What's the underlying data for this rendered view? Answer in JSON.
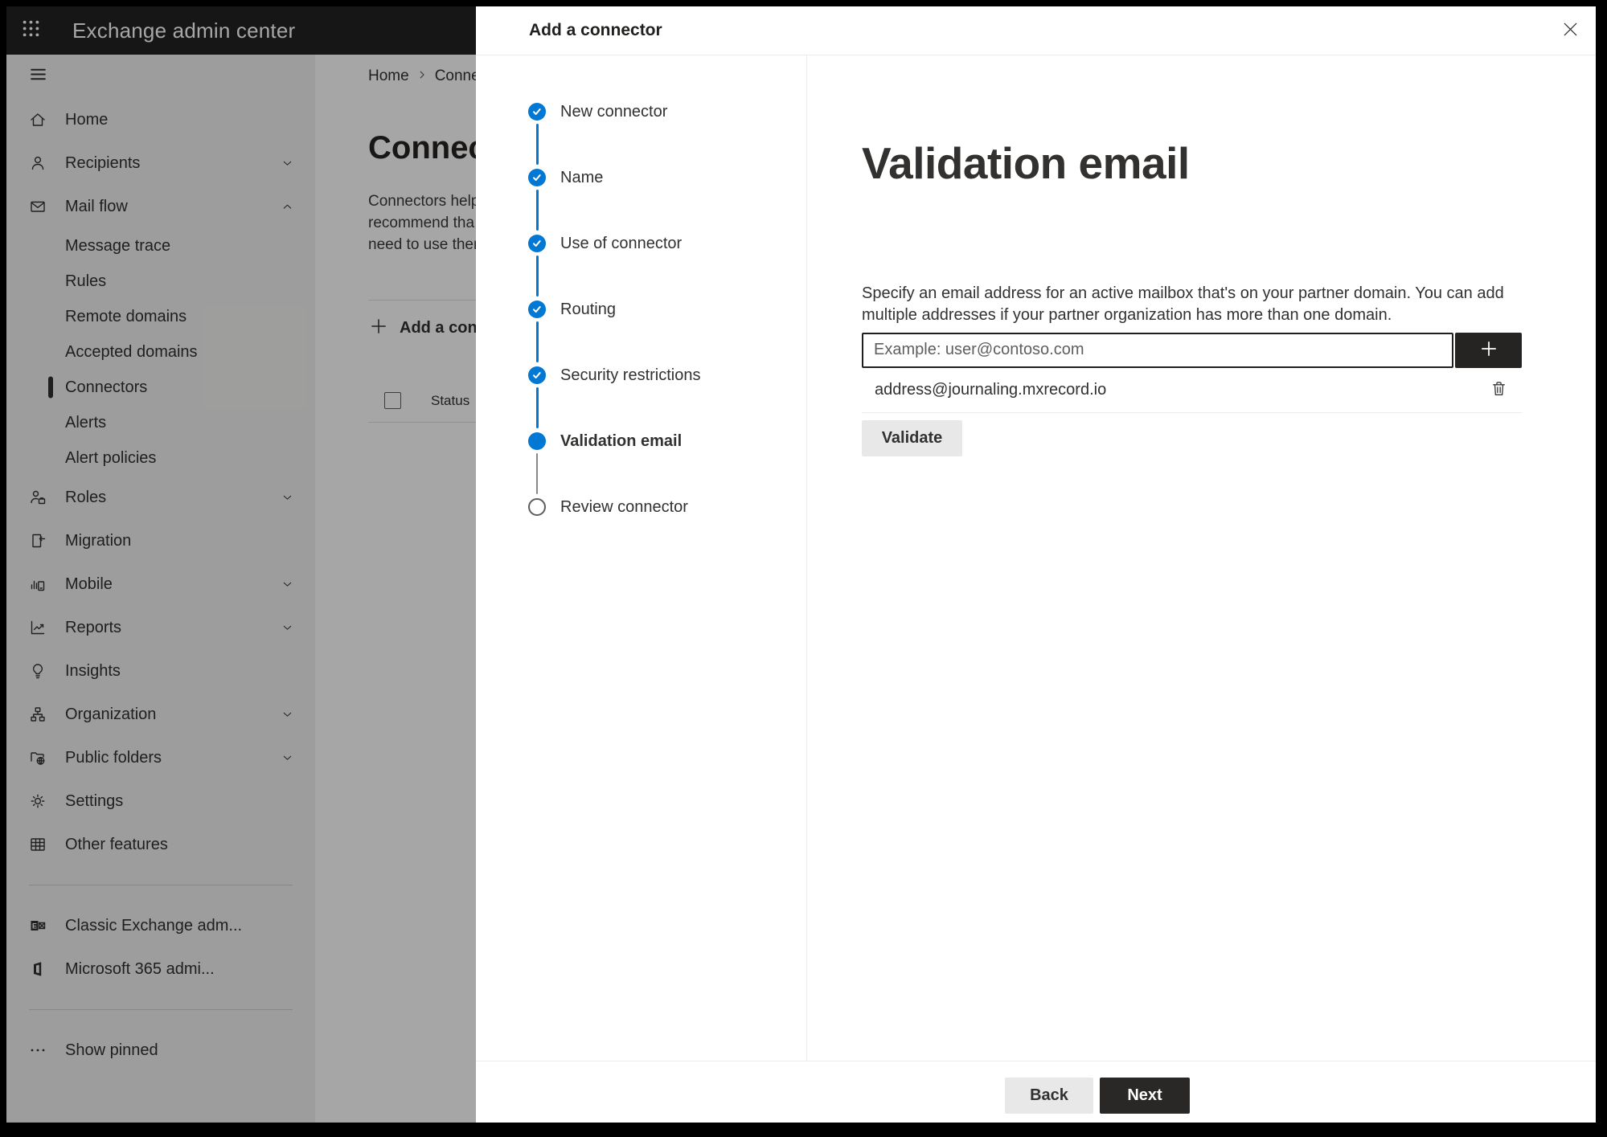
{
  "colors": {
    "accent_blue": "#0078d4",
    "dark_button": "#292827",
    "topbar": "#242322",
    "sidebar_bg": "#f3f2f1",
    "overlay": "rgba(0,0,0,0.35)"
  },
  "topbar": {
    "title": "Exchange admin center",
    "waffle_icon": "app-launcher-icon"
  },
  "sidebar": {
    "items": [
      {
        "label": "Home",
        "icon": "home-icon",
        "type": "top"
      },
      {
        "label": "Recipients",
        "icon": "person-icon",
        "type": "top",
        "chevron": "down"
      },
      {
        "label": "Mail flow",
        "icon": "mail-icon",
        "type": "top",
        "chevron": "up"
      },
      {
        "label": "Message trace",
        "type": "sub"
      },
      {
        "label": "Rules",
        "type": "sub"
      },
      {
        "label": "Remote domains",
        "type": "sub"
      },
      {
        "label": "Accepted domains",
        "type": "sub"
      },
      {
        "label": "Connectors",
        "type": "sub",
        "selected": true
      },
      {
        "label": "Alerts",
        "type": "sub"
      },
      {
        "label": "Alert policies",
        "type": "sub"
      },
      {
        "label": "Roles",
        "icon": "person-briefcase-icon",
        "type": "top",
        "chevron": "down"
      },
      {
        "label": "Migration",
        "icon": "migration-icon",
        "type": "top"
      },
      {
        "label": "Mobile",
        "icon": "mobile-chart-icon",
        "type": "top",
        "chevron": "down"
      },
      {
        "label": "Reports",
        "icon": "chart-trend-icon",
        "type": "top",
        "chevron": "down"
      },
      {
        "label": "Insights",
        "icon": "lightbulb-icon",
        "type": "top"
      },
      {
        "label": "Organization",
        "icon": "org-tree-icon",
        "type": "top",
        "chevron": "down"
      },
      {
        "label": "Public folders",
        "icon": "folder-globe-icon",
        "type": "top",
        "chevron": "down"
      },
      {
        "label": "Settings",
        "icon": "gear-icon",
        "type": "top"
      },
      {
        "label": "Other features",
        "icon": "table-grid-icon",
        "type": "top"
      },
      {
        "divider": true
      },
      {
        "label": "Classic Exchange adm...",
        "icon": "exchange-logo-icon",
        "type": "top"
      },
      {
        "label": "Microsoft 365 admi...",
        "icon": "office-logo-icon",
        "type": "top"
      },
      {
        "divider": true
      },
      {
        "label": "Show pinned",
        "icon": "ellipsis-icon",
        "type": "top"
      }
    ]
  },
  "background_page": {
    "breadcrumb_home": "Home",
    "breadcrumb_current": "Conne",
    "title": "Connec",
    "description": "Connectors help\nrecommend tha\nneed to use ther",
    "add_button_label": "Add a conn",
    "status_header": "Status"
  },
  "modal": {
    "title": "Add a connector",
    "close_icon": "close-icon",
    "steps": [
      {
        "label": "New connector",
        "state": "done"
      },
      {
        "label": "Name",
        "state": "done"
      },
      {
        "label": "Use of connector",
        "state": "done"
      },
      {
        "label": "Routing",
        "state": "done"
      },
      {
        "label": "Security restrictions",
        "state": "done"
      },
      {
        "label": "Validation email",
        "state": "current"
      },
      {
        "label": "Review connector",
        "state": "todo"
      }
    ],
    "content": {
      "heading": "Validation email",
      "description": "Specify an email address for an active mailbox that's on your partner domain. You can add\nmultiple addresses if your partner organization has more than one domain.",
      "input_placeholder": "Example: user@contoso.com",
      "addresses": [
        {
          "email": "address@journaling.mxrecord.io"
        }
      ],
      "validate_label": "Validate"
    },
    "footer": {
      "back_label": "Back",
      "next_label": "Next"
    }
  }
}
